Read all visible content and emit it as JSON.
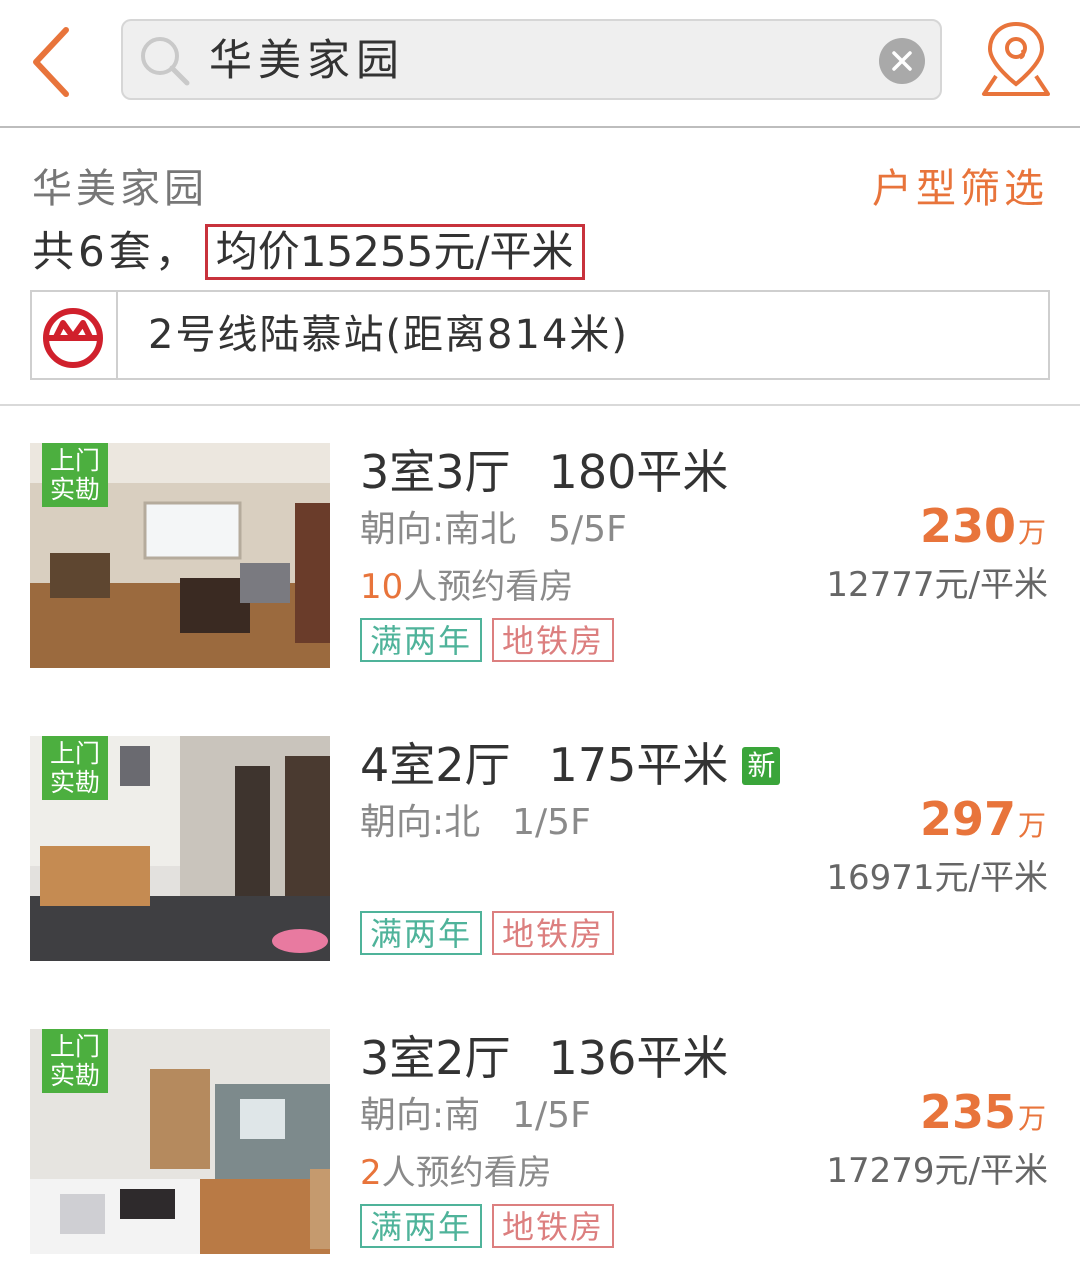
{
  "search": {
    "query": "华美家园"
  },
  "community": {
    "name": "华美家园",
    "filter_label": "户型筛选",
    "count_text": "共6套，",
    "avg_price_text": "均价15255元/平米",
    "metro_text": "2号线陆慕站(距离814米)"
  },
  "colors": {
    "accent": "#e8743b",
    "badge_green": "#4caf3f",
    "tag_green": "#4fb39a",
    "tag_red": "#dc7f7f",
    "highlight_border": "#c8323c",
    "metro_red": "#d0202c"
  },
  "listings": [
    {
      "badge": [
        "上门",
        "实勘"
      ],
      "layout": "3室3厅",
      "area": "180平米",
      "is_new": false,
      "orientation": "朝向:南北",
      "floor": "5/5F",
      "views_count": "10",
      "views_suffix": "人预约看房",
      "tags": [
        "满两年",
        "地铁房"
      ],
      "price": "230",
      "price_unit": "万",
      "unit_price": "12777元/平米"
    },
    {
      "badge": [
        "上门",
        "实勘"
      ],
      "layout": "4室2厅",
      "area": "175平米",
      "is_new": true,
      "new_label": "新",
      "orientation": "朝向:北",
      "floor": "1/5F",
      "tags": [
        "满两年",
        "地铁房"
      ],
      "price": "297",
      "price_unit": "万",
      "unit_price": "16971元/平米"
    },
    {
      "badge": [
        "上门",
        "实勘"
      ],
      "layout": "3室2厅",
      "area": "136平米",
      "is_new": false,
      "orientation": "朝向:南",
      "floor": "1/5F",
      "views_count": "2",
      "views_suffix": "人预约看房",
      "tags": [
        "满两年",
        "地铁房"
      ],
      "price": "235",
      "price_unit": "万",
      "unit_price": "17279元/平米"
    }
  ]
}
